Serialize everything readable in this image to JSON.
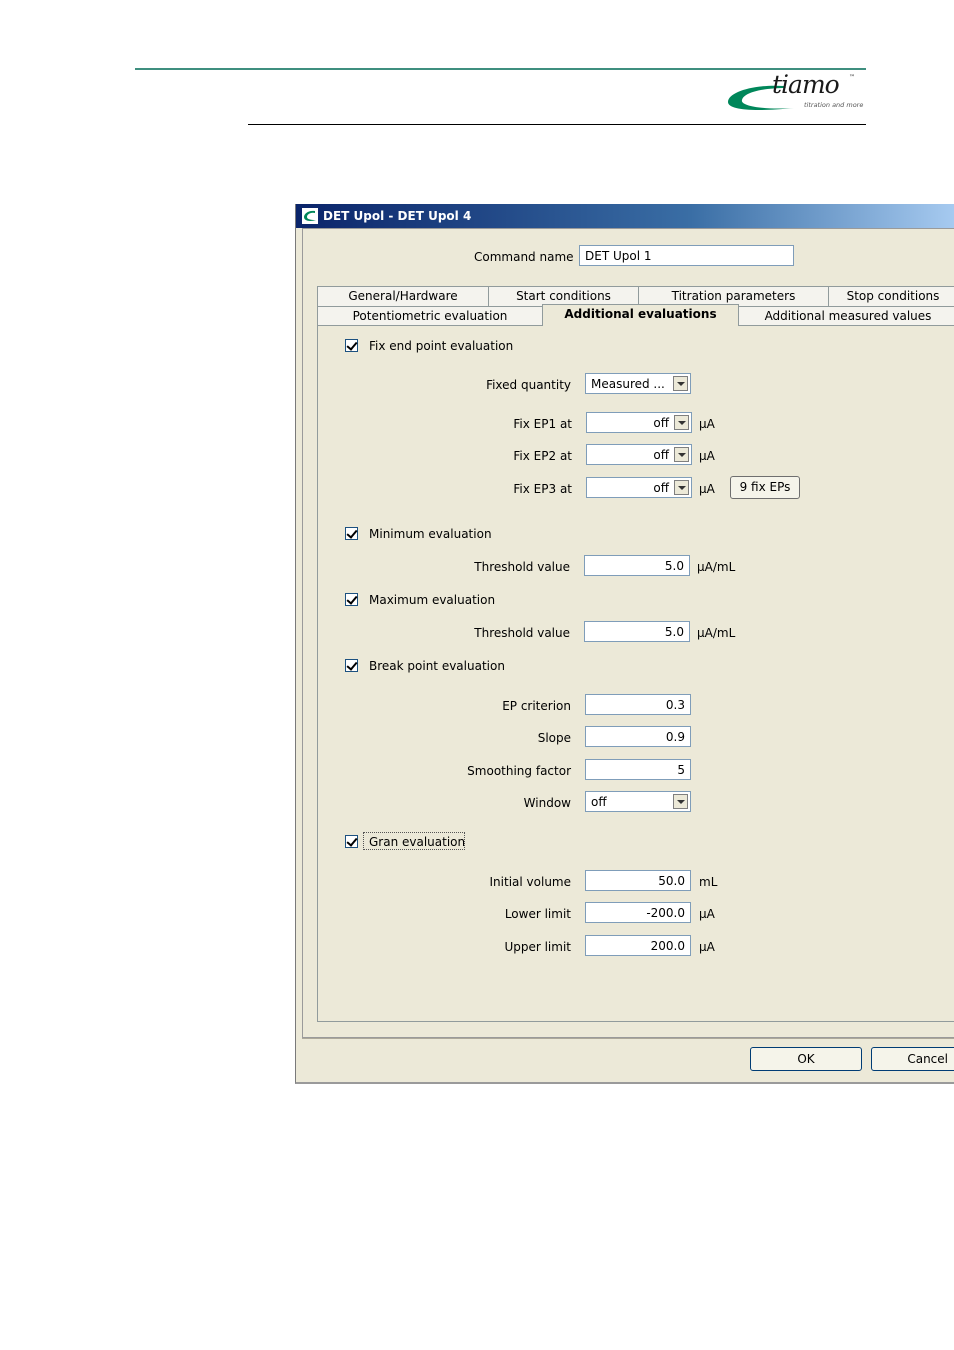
{
  "brand": {
    "name": "tiamo",
    "trademark": "™",
    "tagline": "titration and more",
    "color": "#00875a"
  },
  "dialog": {
    "title": "DET Upol - DET Upol 4",
    "command_name_label": "Command name",
    "command_name_value": "DET Upol 1",
    "tabs_row1": [
      "General/Hardware",
      "Start conditions",
      "Titration parameters",
      "Stop conditions"
    ],
    "tabs_row2": [
      "Potentiometric evaluation",
      "Additional evaluations",
      "Additional measured values"
    ],
    "active_tab": "Additional evaluations",
    "fix_ep": {
      "checkbox_label": "Fix end point evaluation",
      "checked": true,
      "fixed_quantity_label": "Fixed quantity",
      "fixed_quantity_value": "Measured ...",
      "ep1_label": "Fix EP1 at",
      "ep1_value": "off",
      "ep1_unit": "µA",
      "ep2_label": "Fix EP2 at",
      "ep2_value": "off",
      "ep2_unit": "µA",
      "ep3_label": "Fix EP3 at",
      "ep3_value": "off",
      "ep3_unit": "µA",
      "nine_fix_button": "9 fix EPs"
    },
    "minimum": {
      "checkbox_label": "Minimum evaluation",
      "checked": true,
      "threshold_label": "Threshold value",
      "threshold_value": "5.0",
      "unit": "µA/mL"
    },
    "maximum": {
      "checkbox_label": "Maximum evaluation",
      "checked": true,
      "threshold_label": "Threshold value",
      "threshold_value": "5.0",
      "unit": "µA/mL"
    },
    "break_point": {
      "checkbox_label": "Break point evaluation",
      "checked": true,
      "ep_criterion_label": "EP criterion",
      "ep_criterion_value": "0.3",
      "slope_label": "Slope",
      "slope_value": "0.9",
      "smoothing_label": "Smoothing factor",
      "smoothing_value": "5",
      "window_label": "Window",
      "window_value": "off"
    },
    "gran": {
      "checkbox_label": "Gran evaluation",
      "checked": true,
      "initial_volume_label": "Initial volume",
      "initial_volume_value": "50.0",
      "initial_volume_unit": "mL",
      "lower_limit_label": "Lower limit",
      "lower_limit_value": "-200.0",
      "lower_limit_unit": "µA",
      "upper_limit_label": "Upper limit",
      "upper_limit_value": "200.0",
      "upper_limit_unit": "µA"
    },
    "ok_button": "OK",
    "cancel_button": "Cancel"
  }
}
